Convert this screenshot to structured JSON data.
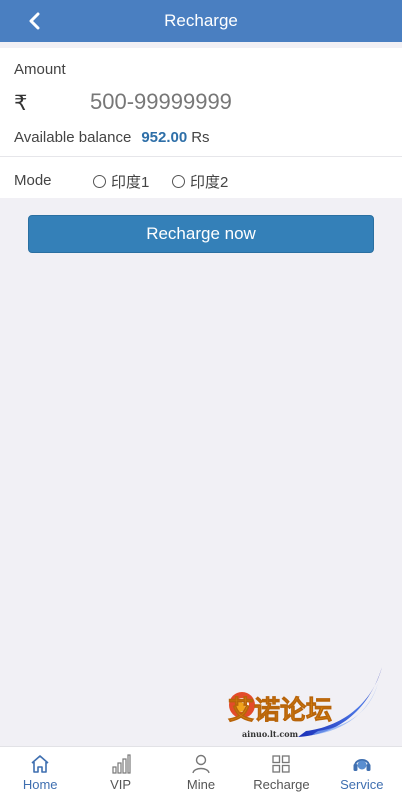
{
  "header": {
    "title": "Recharge"
  },
  "form": {
    "amount_label": "Amount",
    "currency_symbol": "₹",
    "amount_placeholder": "500-99999999",
    "balance_label": "Available balance",
    "balance_value": "952.00",
    "balance_unit": "Rs",
    "mode_label": "Mode",
    "mode_options": [
      "印度1",
      "印度2"
    ],
    "submit_label": "Recharge now"
  },
  "watermark": {
    "text": "艾诺论坛",
    "url": "ainuo.lt.com"
  },
  "tabbar": {
    "items": [
      {
        "label": "Home",
        "icon": "home-icon",
        "active": true
      },
      {
        "label": "VIP",
        "icon": "bar-chart-icon",
        "active": false
      },
      {
        "label": "Mine",
        "icon": "user-icon",
        "active": false
      },
      {
        "label": "Recharge",
        "icon": "grid-icon",
        "active": false
      },
      {
        "label": "Service",
        "icon": "headset-icon",
        "active": false
      }
    ]
  },
  "colors": {
    "header_bg": "#4a7fc1",
    "button_bg": "#3480b8",
    "balance_value": "#2e6fa8",
    "active_tab": "#3f6fb0",
    "page_bg": "#f1f0f5"
  }
}
